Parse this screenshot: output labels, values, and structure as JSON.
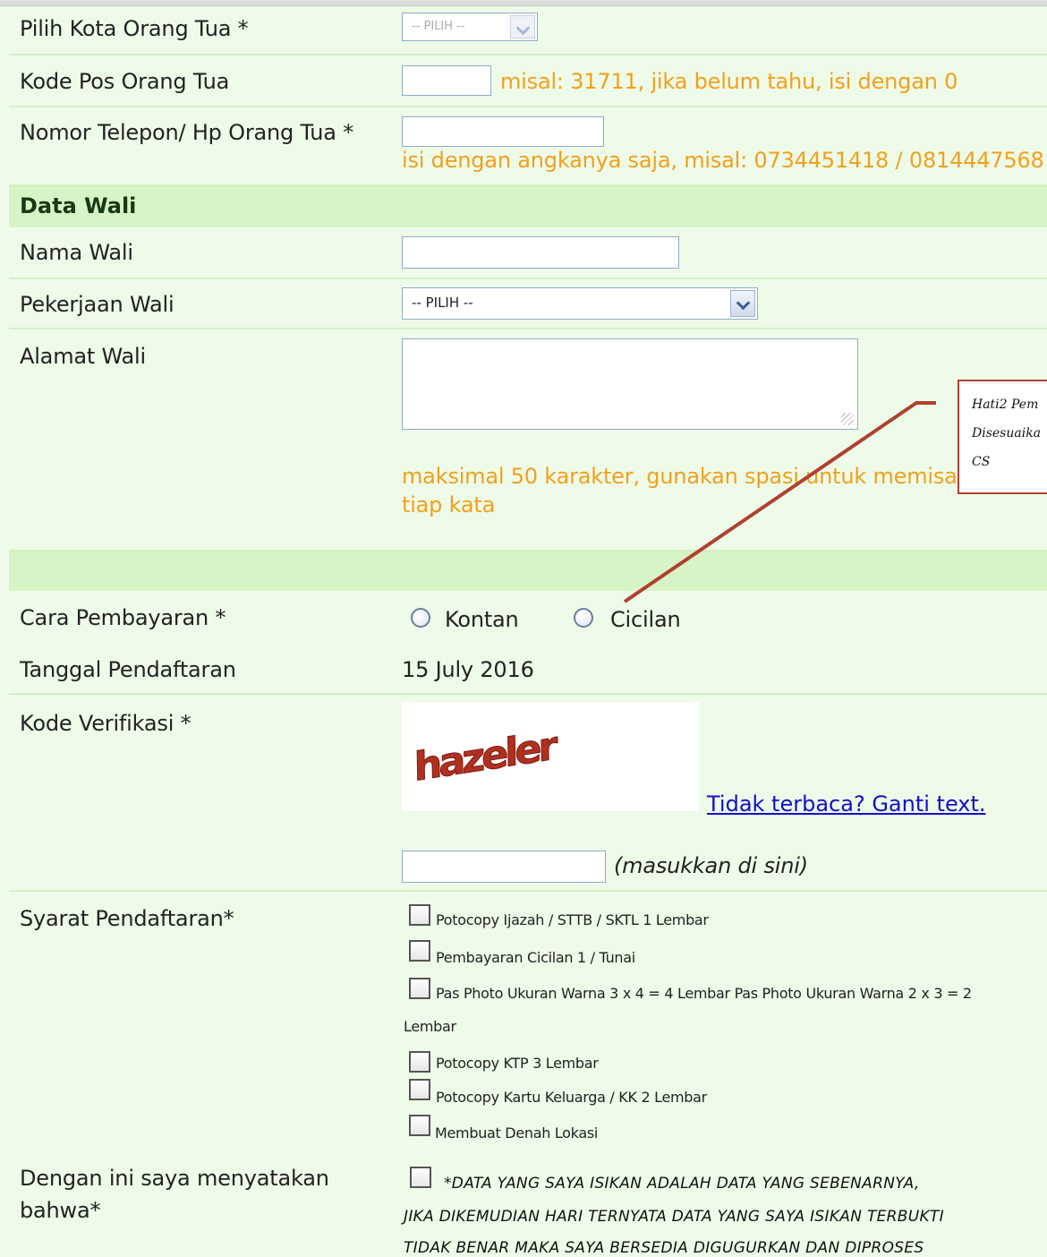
{
  "rows": {
    "kota_label": "Pilih Kota Orang Tua *",
    "kota_select": "-- PILIH --",
    "kodepos_label": "Kode Pos Orang Tua",
    "kodepos_hint": "misal: 31711, jika belum tahu, isi dengan 0",
    "telp_label": "Nomor Telepon/ Hp Orang Tua *",
    "telp_hint": "isi dengan angkanya saja, misal: 0734451418 / 0814447568"
  },
  "wali": {
    "section_title": "Data Wali",
    "nama_label": "Nama Wali",
    "pekerjaan_label": "Pekerjaan Wali",
    "pekerjaan_select": "-- PILIH --",
    "alamat_label": "Alamat Wali",
    "alamat_hint_line1": "maksimal 50 karakter, gunakan spasi untuk memisa",
    "alamat_hint_line2": "tiap kata"
  },
  "callout": {
    "line1": "Hati2 Pem",
    "line2": "Disesuaika",
    "line3": "CS"
  },
  "payment": {
    "label": "Cara Pembayaran *",
    "option1": "Kontan",
    "option2": "Cicilan"
  },
  "tanggal": {
    "label": "Tanggal Pendaftaran",
    "value": "15 July 2016"
  },
  "verifikasi": {
    "label": "Kode Verifikasi *",
    "captcha_text": "hazeler",
    "refresh_link": "Tidak terbaca? Ganti text.",
    "input_hint": "(masukkan di sini)"
  },
  "syarat": {
    "label": "Syarat Pendaftaran*",
    "items": [
      "Potocopy Ijazah / STTB / SKTL 1 Lembar",
      "Pembayaran Cicilan 1 / Tunai",
      "Pas Photo Ukuran Warna 3 x 4 = 4 Lembar Pas Photo Ukuran Warna 2 x 3 = 2",
      "Potocopy KTP 3 Lembar",
      "Potocopy Kartu Keluarga / KK 2 Lembar",
      "Membuat Denah Lokasi"
    ],
    "item3_cont": "Lembar"
  },
  "pernyataan": {
    "label_line1": "Dengan ini saya menyatakan",
    "label_line2": "bahwa*",
    "line1": "*DATA YANG SAYA ISIKAN ADALAH DATA YANG SEBENARNYA,",
    "line2": "JIKA DIKEMUDIAN HARI TERNYATA DATA YANG SAYA ISIKAN TERBUKTI",
    "line3": "TIDAK BENAR MAKA SAYA BERSEDIA DIGUGURKAN DAN DIPROSES"
  },
  "colors": {
    "background": "#eefbe8",
    "section": "#d7f4c6",
    "hint": "#f2a01c",
    "link": "#1010cc",
    "callout_border": "#b04030"
  }
}
